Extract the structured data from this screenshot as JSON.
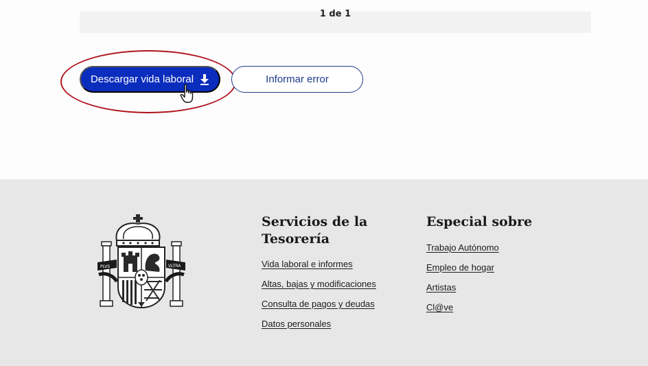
{
  "pagination": {
    "text": "1 de 1"
  },
  "actions": {
    "download_label": "Descargar vida laboral",
    "report_label": "Informar error"
  },
  "footer": {
    "coat_of_arms": {
      "motto_left": "PLVS",
      "motto_right": "VLTRA"
    },
    "services": {
      "title": "Servicios de la Tesorería",
      "links": [
        "Vida laboral e informes",
        "Altas, bajas y modificaciones",
        "Consulta de pagos y deudas",
        "Datos personales"
      ]
    },
    "special": {
      "title": "Especial sobre",
      "links": [
        "Trabajo Autónomo",
        "Empleo de hogar",
        "Artistas",
        "Cl@ve"
      ]
    }
  },
  "colors": {
    "primary_button": "#0b2dbd",
    "outline_button": "#1d3a8a",
    "highlight": "#b0141e",
    "footer_background": "#e8e7e8"
  },
  "icons": {
    "download": "download-icon",
    "cursor": "hand-pointer-cursor"
  }
}
